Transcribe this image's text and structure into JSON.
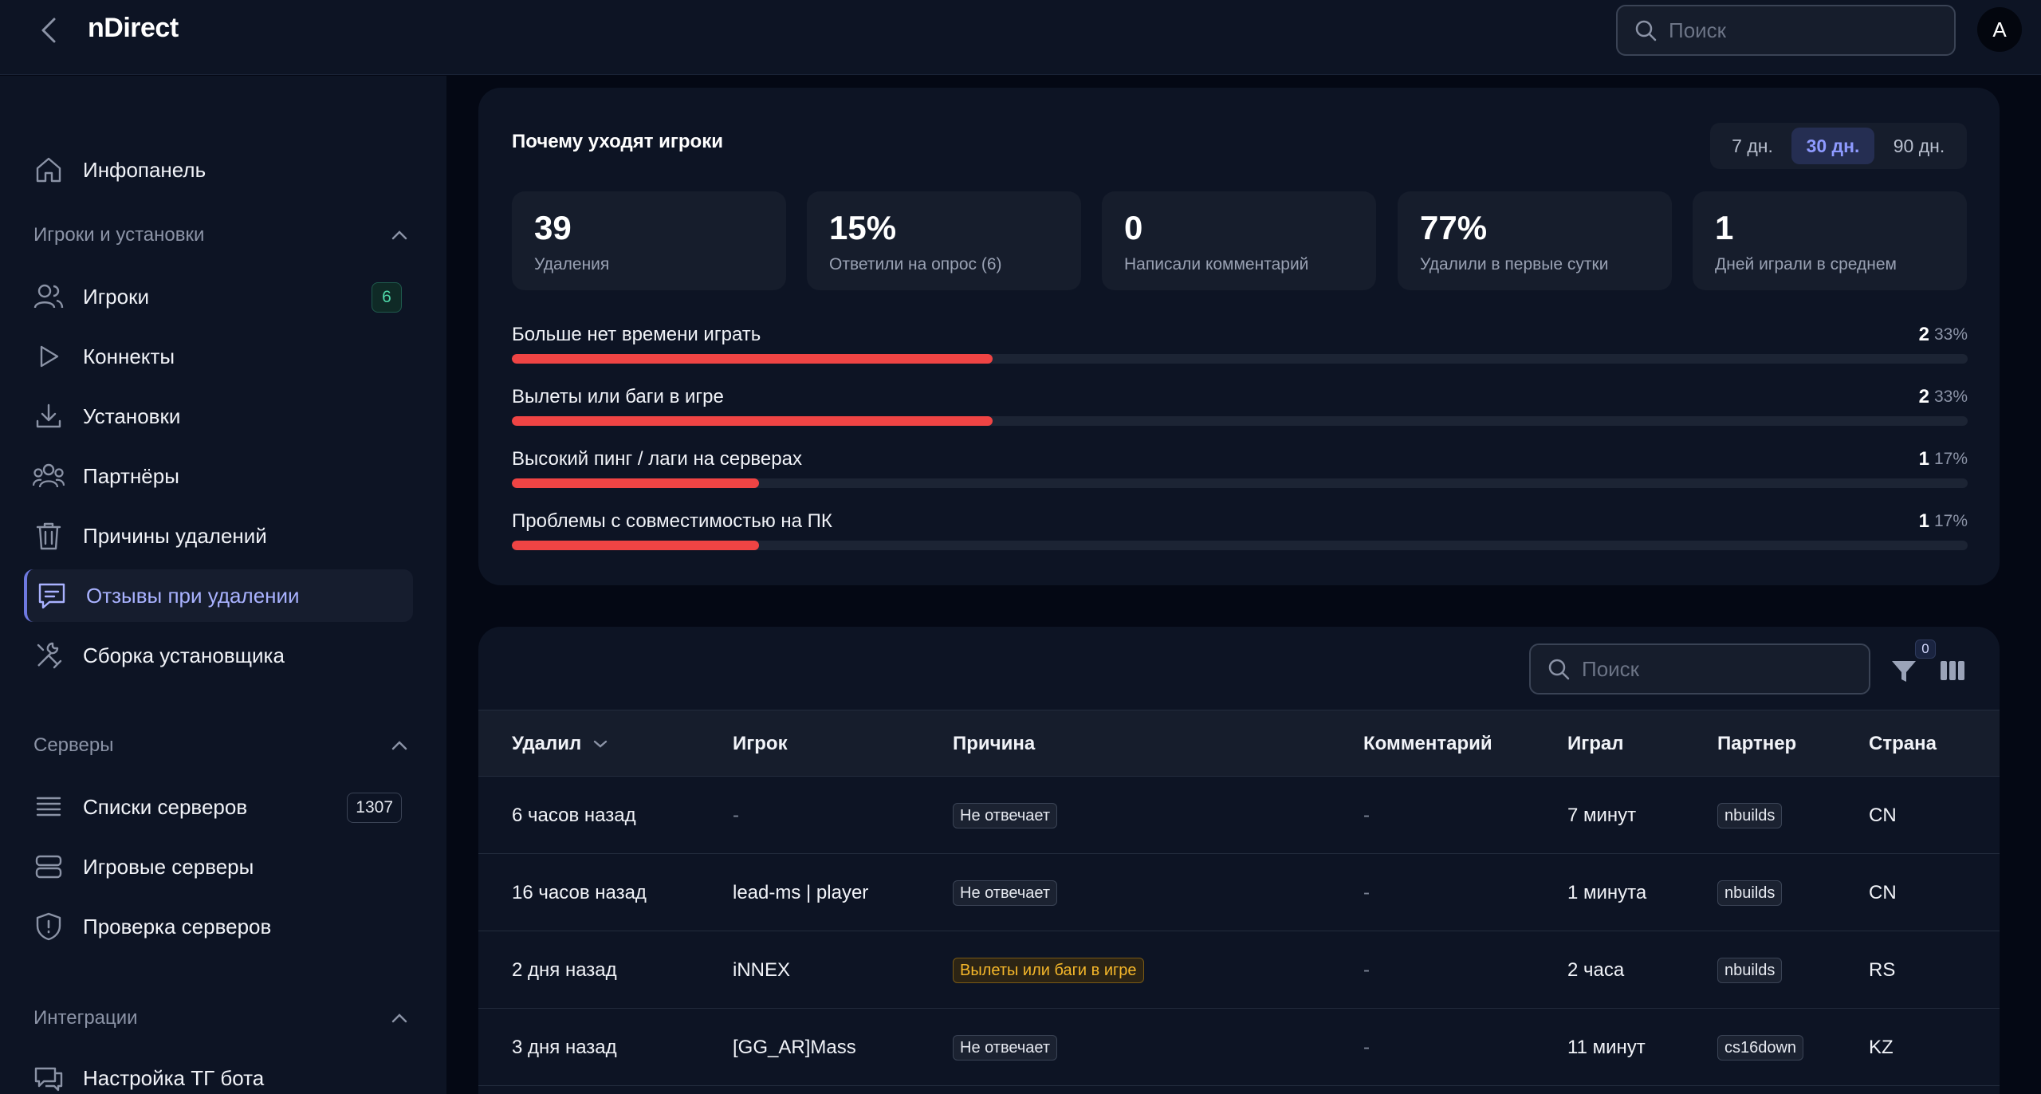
{
  "app": {
    "title": "nDirect",
    "avatar_letter": "A"
  },
  "top_search": {
    "placeholder": "Поиск"
  },
  "sidebar": {
    "dashboard": "Инфопанель",
    "sections": [
      {
        "title": "Игроки и установки",
        "items": [
          {
            "label": "Игроки",
            "badge": "6",
            "icon": "users-icon"
          },
          {
            "label": "Коннекты",
            "icon": "play-icon"
          },
          {
            "label": "Установки",
            "icon": "download-icon"
          },
          {
            "label": "Партнёры",
            "icon": "partners-icon"
          },
          {
            "label": "Причины удалений",
            "icon": "trash-icon"
          },
          {
            "label": "Отзывы при удалении",
            "icon": "message-icon",
            "active": true
          },
          {
            "label": "Сборка установщика",
            "icon": "tools-icon"
          }
        ]
      },
      {
        "title": "Серверы",
        "items": [
          {
            "label": "Списки серверов",
            "badge": "1307",
            "icon": "list-icon"
          },
          {
            "label": "Игровые серверы",
            "icon": "server-icon"
          },
          {
            "label": "Проверка серверов",
            "icon": "shield-icon"
          }
        ]
      },
      {
        "title": "Интеграции",
        "items": [
          {
            "label": "Настройка ТГ бота",
            "icon": "chat-icon"
          }
        ]
      }
    ]
  },
  "churn": {
    "title": "Почему уходят игроки",
    "periods": [
      "7 дн.",
      "30 дн.",
      "90 дн."
    ],
    "selected_period": "30 дн.",
    "stats": [
      {
        "value": "39",
        "label": "Удаления"
      },
      {
        "value": "15%",
        "label": "Ответили на опрос (6)"
      },
      {
        "value": "0",
        "label": "Написали комментарий"
      },
      {
        "value": "77%",
        "label": "Удалили в первые сутки"
      },
      {
        "value": "1",
        "label": "Дней играли в среднем"
      }
    ],
    "reasons": [
      {
        "label": "Больше нет времени играть",
        "count": "2",
        "percent": "33%",
        "share": 0.33
      },
      {
        "label": "Вылеты или баги в игре",
        "count": "2",
        "percent": "33%",
        "share": 0.33
      },
      {
        "label": "Высокий пинг / лаги на серверах",
        "count": "1",
        "percent": "17%",
        "share": 0.17
      },
      {
        "label": "Проблемы с совместимостью на ПК",
        "count": "1",
        "percent": "17%",
        "share": 0.17
      }
    ],
    "accent_color": "#ef4444"
  },
  "table": {
    "search_placeholder": "Поиск",
    "filter_count": "0",
    "columns": [
      "Удалил",
      "Игрок",
      "Причина",
      "Комментарий",
      "Играл",
      "Партнер",
      "Страна"
    ],
    "rows": [
      {
        "deleted": "6 часов назад",
        "player": "-",
        "reason": "Не отвечает",
        "reason_style": "neutral",
        "comment": "-",
        "played": "7 минут",
        "partner": "nbuilds",
        "country": "CN"
      },
      {
        "deleted": "16 часов назад",
        "player": "lead-ms | player",
        "reason": "Не отвечает",
        "reason_style": "neutral",
        "comment": "-",
        "played": "1 минута",
        "partner": "nbuilds",
        "country": "CN"
      },
      {
        "deleted": "2 дня назад",
        "player": "iNNEX",
        "reason": "Вылеты или баги в игре",
        "reason_style": "warn",
        "comment": "-",
        "played": "2 часа",
        "partner": "nbuilds",
        "country": "RS"
      },
      {
        "deleted": "3 дня назад",
        "player": "[GG_AR]Mass",
        "reason": "Не отвечает",
        "reason_style": "neutral",
        "comment": "-",
        "played": "11 минут",
        "partner": "cs16down",
        "country": "KZ"
      }
    ]
  }
}
